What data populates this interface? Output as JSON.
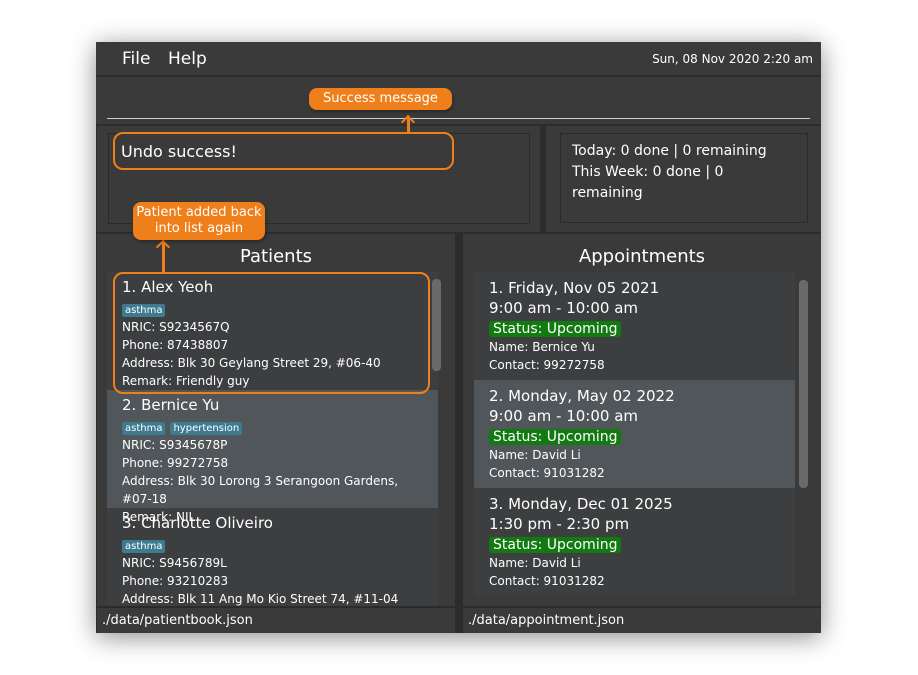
{
  "menu": {
    "file": "File",
    "help": "Help",
    "datetime": "Sun, 08 Nov 2020 2:20 am"
  },
  "result": {
    "message": "Undo success!"
  },
  "stats": {
    "today": "Today: 0 done | 0 remaining",
    "week": "This Week: 0 done | 0 remaining"
  },
  "patients": {
    "title": "Patients",
    "items": [
      {
        "name": "1.  Alex Yeoh",
        "tags": [
          "asthma"
        ],
        "nric": "NRIC: S9234567Q",
        "phone": "Phone: 87438807",
        "address": "Address: Blk 30 Geylang Street 29, #06-40",
        "remark": "Remark: Friendly guy"
      },
      {
        "name": "2.  Bernice Yu",
        "tags": [
          "asthma",
          "hypertension"
        ],
        "nric": "NRIC: S9345678P",
        "phone": "Phone: 99272758",
        "address": "Address: Blk 30 Lorong 3 Serangoon Gardens, #07-18",
        "remark": "Remark: NIL"
      },
      {
        "name": "3.  Charlotte Oliveiro",
        "tags": [
          "asthma"
        ],
        "nric": "NRIC: S9456789L",
        "phone": "Phone: 93210283",
        "address": "Address: Blk 11 Ang Mo Kio Street 74, #11-04",
        "remark": ""
      }
    ]
  },
  "appointments": {
    "title": "Appointments",
    "items": [
      {
        "date": "1.  Friday, Nov 05 2021",
        "time": "9:00 am - 10:00 am",
        "status": "Status: Upcoming",
        "name": "Name: Bernice Yu",
        "contact": "Contact: 99272758"
      },
      {
        "date": "2.  Monday, May 02 2022",
        "time": "9:00 am - 10:00 am",
        "status": "Status: Upcoming",
        "name": "Name: David Li",
        "contact": "Contact: 91031282"
      },
      {
        "date": "3.  Monday, Dec 01 2025",
        "time": "1:30 pm - 2:30 pm",
        "status": "Status: Upcoming",
        "name": "Name: David Li",
        "contact": "Contact: 91031282"
      }
    ]
  },
  "statusbar": {
    "patients_file": "./data/patientbook.json",
    "appointments_file": "./data/appointment.json"
  },
  "annotations": {
    "success": "Success message",
    "patient_added": "Patient added back into list again"
  },
  "colors": {
    "accent": "#ef7f1a",
    "tag": "#3e7b91",
    "status": "#117a11"
  }
}
